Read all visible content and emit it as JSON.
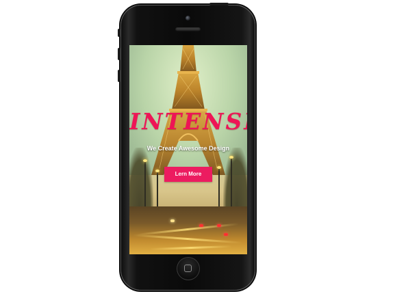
{
  "hero": {
    "title": "INTENSITY",
    "subtitle": "We Create Awesome Design",
    "cta_label": "Lern More"
  },
  "colors": {
    "accent": "#ec1c60",
    "title_pink": "#ee1556",
    "phone_body": "#0b0b0b",
    "background": "#ffffff"
  },
  "icons": {
    "camera": "front-camera-icon",
    "speaker": "earpiece-speaker-icon",
    "home": "home-button-icon"
  }
}
